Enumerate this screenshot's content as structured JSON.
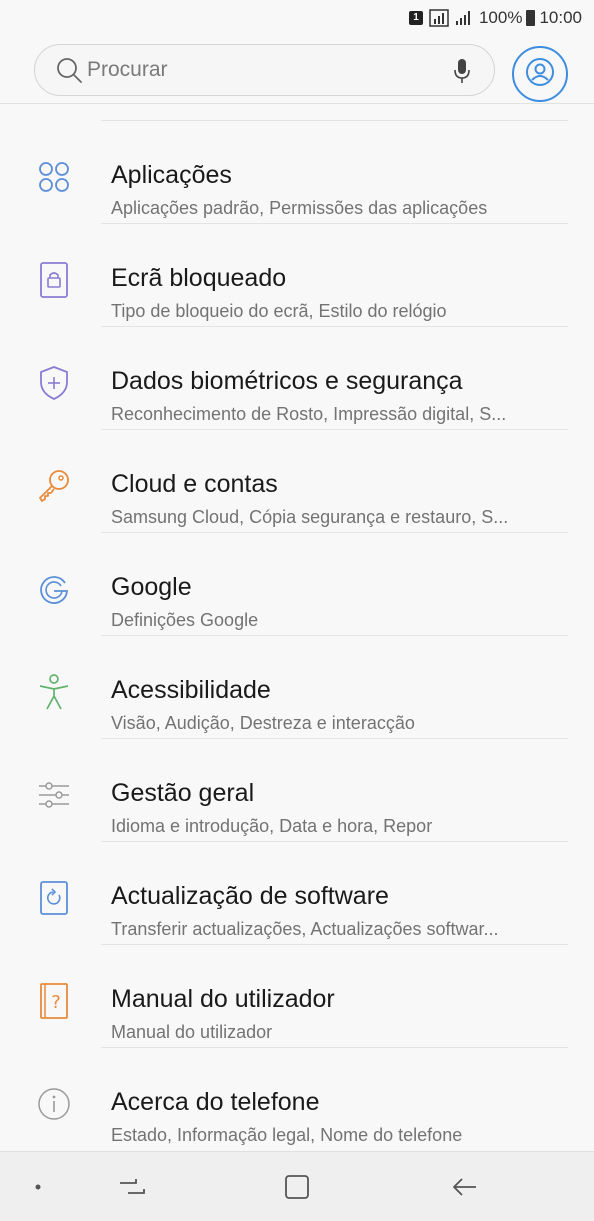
{
  "status_bar": {
    "sim_label": "1",
    "battery_text": "100%",
    "time": "10:00"
  },
  "search": {
    "placeholder": "Procurar"
  },
  "colors": {
    "accent_blue": "#3e8de0",
    "icon_blue": "#5b8fd9",
    "icon_purple": "#8a7cd3",
    "icon_orange": "#e88a3a",
    "icon_green": "#5fb36b",
    "icon_gray": "#9a9a9a"
  },
  "settings": {
    "items": [
      {
        "icon": "apps-icon",
        "title": "Aplicações",
        "subtitle": "Aplicações padrão, Permissões das aplicações"
      },
      {
        "icon": "lock-screen-icon",
        "title": "Ecrã bloqueado",
        "subtitle": "Tipo de bloqueio do ecrã, Estilo do relógio"
      },
      {
        "icon": "shield-icon",
        "title": "Dados biométricos e segurança",
        "subtitle": "Reconhecimento de Rosto, Impressão digital, S..."
      },
      {
        "icon": "key-icon",
        "title": "Cloud e contas",
        "subtitle": "Samsung Cloud, Cópia segurança e restauro, S..."
      },
      {
        "icon": "google-icon",
        "title": "Google",
        "subtitle": "Definições Google"
      },
      {
        "icon": "accessibility-icon",
        "title": "Acessibilidade",
        "subtitle": "Visão, Audição, Destreza e interacção"
      },
      {
        "icon": "sliders-icon",
        "title": "Gestão geral",
        "subtitle": "Idioma e introdução, Data e hora, Repor"
      },
      {
        "icon": "software-update-icon",
        "title": "Actualização de software",
        "subtitle": "Transferir actualizações, Actualizações softwar..."
      },
      {
        "icon": "user-manual-icon",
        "title": "Manual do utilizador",
        "subtitle": "Manual do utilizador"
      },
      {
        "icon": "info-icon",
        "title": "Acerca do telefone",
        "subtitle": "Estado, Informação legal, Nome do telefone"
      }
    ]
  }
}
